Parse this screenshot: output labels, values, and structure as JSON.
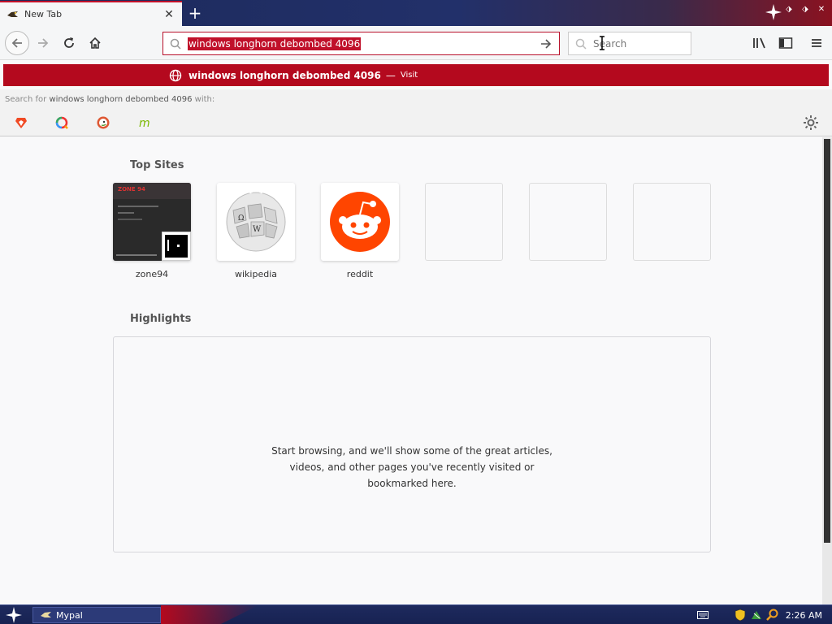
{
  "tab": {
    "title": "New Tab",
    "close_glyph": "✕"
  },
  "newtab_glyph": "+",
  "window_controls": [
    "⬗",
    "⬗",
    "✕"
  ],
  "urlbar": {
    "value": "windows longhorn debombed 4096"
  },
  "searchbar": {
    "placeholder": "Search"
  },
  "suggestion": {
    "text": "windows longhorn debombed 4096",
    "dash": "—",
    "action": "Visit"
  },
  "oneoff": {
    "prefix": "Search for ",
    "query": "windows longhorn debombed 4096",
    "suffix": " with:"
  },
  "topsites": {
    "title": "Top Sites",
    "tiles": [
      {
        "label": "zone94",
        "screenshot_title": "ZONE 94"
      },
      {
        "label": "wikipedia"
      },
      {
        "label": "reddit"
      },
      {
        "label": ""
      },
      {
        "label": ""
      },
      {
        "label": ""
      }
    ]
  },
  "highlights": {
    "title": "Highlights",
    "empty_message": "Start browsing, and we'll show some of the great articles, videos, and other pages you've recently visited or bookmarked here."
  },
  "taskbar": {
    "window_label": "Mypal",
    "clock": "2:26 AM"
  },
  "colors": {
    "accent": "#b4091e",
    "taskbar": "#1e2a5e",
    "reddit": "#ff4500"
  }
}
